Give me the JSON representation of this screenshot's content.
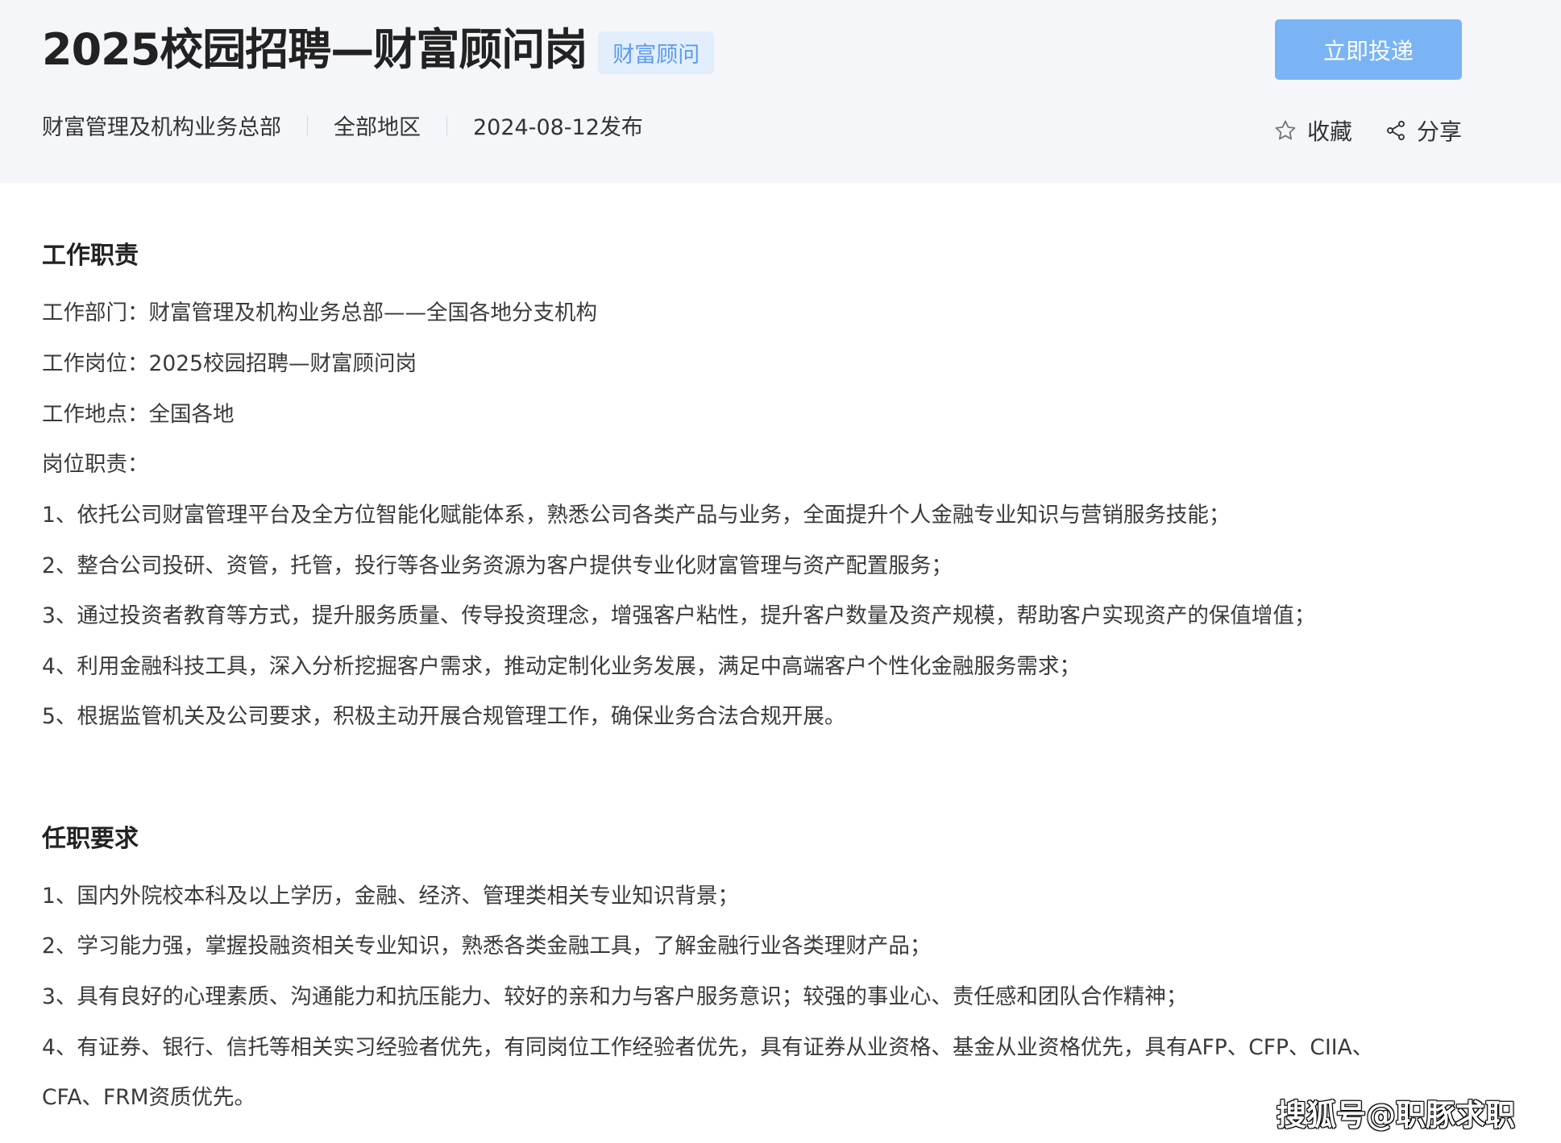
{
  "header": {
    "title": "2025校园招聘—财富顾问岗",
    "tag": "财富顾问",
    "department": "财富管理及机构业务总部",
    "region": "全部地区",
    "published": "2024-08-12发布",
    "apply_label": "立即投递",
    "favorite_label": "收藏",
    "share_label": "分享"
  },
  "duties": {
    "heading": "工作职责",
    "lines": [
      "工作部门：财富管理及机构业务总部——全国各地分支机构",
      "工作岗位：2025校园招聘—财富顾问岗",
      "工作地点：全国各地",
      "岗位职责：",
      "1、依托公司财富管理平台及全方位智能化赋能体系，熟悉公司各类产品与业务，全面提升个人金融专业知识与营销服务技能；",
      "2、整合公司投研、资管，托管，投行等各业务资源为客户提供专业化财富管理与资产配置服务；",
      "3、通过投资者教育等方式，提升服务质量、传导投资理念，增强客户粘性，提升客户数量及资产规模，帮助客户实现资产的保值增值；",
      "4、利用金融科技工具，深入分析挖掘客户需求，推动定制化业务发展，满足中高端客户个性化金融服务需求；",
      "5、根据监管机关及公司要求，积极主动开展合规管理工作，确保业务合法合规开展。"
    ]
  },
  "requirements": {
    "heading": "任职要求",
    "lines": [
      "1、国内外院校本科及以上学历，金融、经济、管理类相关专业知识背景；",
      "2、学习能力强，掌握投融资相关专业知识，熟悉各类金融工具，了解金融行业各类理财产品；",
      "3、具有良好的心理素质、沟通能力和抗压能力、较好的亲和力与客户服务意识；较强的事业心、责任感和团队合作精神；",
      "4、有证券、银行、信托等相关实习经验者优先，有同岗位工作经验者优先，具有证券从业资格、基金从业资格优先，具有AFP、CFP、CIIA、",
      "CFA、FRM资质优先。"
    ]
  },
  "watermark": "搜狐号@职豚求职",
  "colors": {
    "header_bg": "#f4f6f9",
    "accent": "#7ab4f4",
    "tag_bg": "#e3eefc",
    "tag_text": "#5a9bf0"
  },
  "icons": {
    "favorite": "star-outline-icon",
    "share": "share-nodes-icon"
  }
}
